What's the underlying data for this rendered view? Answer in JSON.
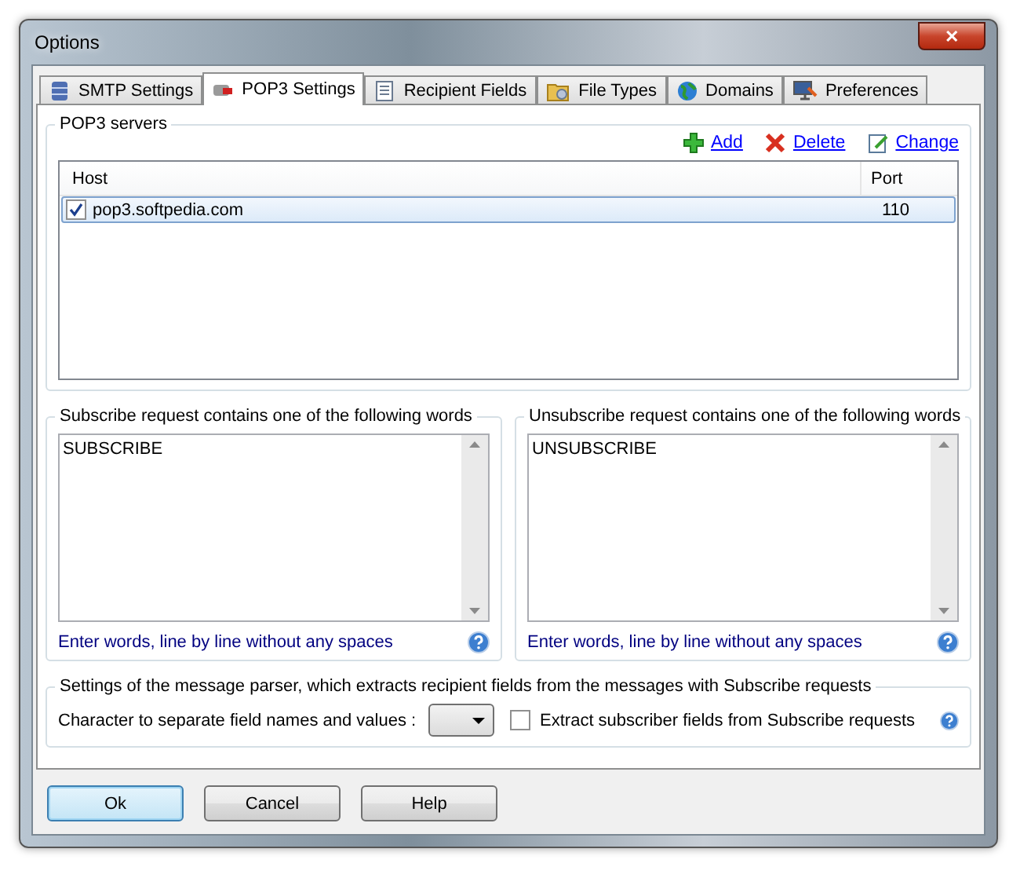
{
  "window": {
    "title": "Options",
    "close": "✕"
  },
  "tabs": [
    {
      "label": "SMTP Settings",
      "selected": false
    },
    {
      "label": "POP3 Settings",
      "selected": true
    },
    {
      "label": "Recipient Fields",
      "selected": false
    },
    {
      "label": "File Types",
      "selected": false
    },
    {
      "label": "Domains",
      "selected": false
    },
    {
      "label": "Preferences",
      "selected": false
    }
  ],
  "pop3_servers": {
    "title": "POP3 servers",
    "actions": [
      "Add",
      "Delete",
      "Change"
    ],
    "columns": [
      "Host",
      "Port"
    ],
    "rows": [
      {
        "host": "pop3.softpedia.com",
        "port": "110",
        "checked": true,
        "selected": true
      }
    ]
  },
  "word_lists": [
    {
      "title": "Subscribe request contains one of the following words",
      "value": "SUBSCRIBE",
      "hint": "Enter words, line by line without any spaces"
    },
    {
      "title": "Unsubscribe request contains one of the following words",
      "value": "UNSUBSCRIBE",
      "hint": "Enter words, line by line without any spaces"
    }
  ],
  "parser": {
    "title": "Settings of the message parser, which extracts recipient fields from the messages with Subscribe requests",
    "separator_label": "Character to separate field names and values :",
    "extract_label": "Extract subscriber fields from Subscribe requests",
    "extract_checked": false
  },
  "buttons": [
    {
      "label": "Ok",
      "default": true
    },
    {
      "label": "Cancel",
      "default": false
    },
    {
      "label": "Help",
      "default": false
    }
  ]
}
